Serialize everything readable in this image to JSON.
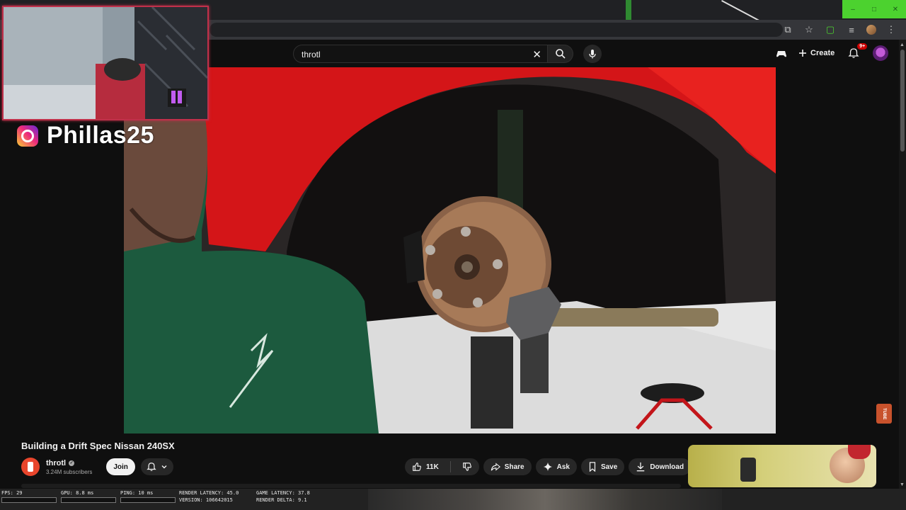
{
  "browser": {
    "window_controls": [
      "–",
      "□",
      "✕"
    ],
    "addr_icons": [
      "cast-icon",
      "star-icon",
      "extension-icon",
      "playlist-icon",
      "profile-avatar",
      "kebab-icon"
    ]
  },
  "header": {
    "search_query": "throtl",
    "create_label": "Create",
    "notification_badge": "9+"
  },
  "overlay": {
    "instagram_handle": "Phillas25"
  },
  "video": {
    "title": "Building a Drift Spec Nissan 240SX",
    "channel": {
      "name": "throtl",
      "subscribers": "3.24M subscribers",
      "join_label": "Join"
    },
    "actions": {
      "like_count": "11K",
      "share_label": "Share",
      "ask_label": "Ask",
      "save_label": "Save",
      "download_label": "Download"
    },
    "watermark": "TUBE"
  },
  "perf_overlay": {
    "fps": "FPS: 29",
    "gpu": "GPU: 8.8 ms",
    "ping": "PING: 10 ms",
    "render_latency": "RENDER LATENCY: 45.0",
    "version": "VERSION: 106642015",
    "game_latency": "GAME LATENCY: 37.8",
    "render_delta": "RENDER DELTA: 9.1"
  },
  "colors": {
    "accent_red": "#cc0000",
    "webcam_border": "#c0304a",
    "window_controls_green": "#4cd22f"
  }
}
